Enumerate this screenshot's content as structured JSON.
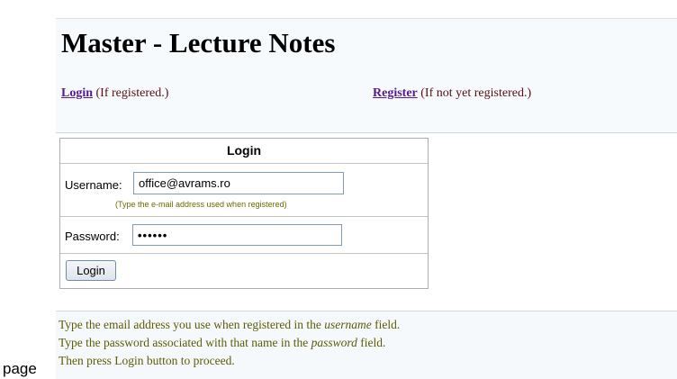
{
  "header": {
    "title": "Master - Lecture Notes",
    "nav": {
      "login_link": "Login",
      "login_note": " (If registered.)",
      "register_link": "Register",
      "register_note": " (If not yet registered.)"
    }
  },
  "login_form": {
    "heading": "Login",
    "username": {
      "label": "Username:",
      "value": "office@avrams.ro",
      "hint": "(Type the e-mail address used when registered)"
    },
    "password": {
      "label": "Password:",
      "masked_value": "••••••"
    },
    "submit_label": "Login"
  },
  "instructions": {
    "line1_a": "Type the email address you use when registered in the ",
    "line1_em": "username",
    "line1_b": " field.",
    "line2_a": "Type the password associated with that name in the ",
    "line2_em": "password",
    "line2_b": " field.",
    "line3": "Then press Login button to proceed."
  },
  "page_label": "page",
  "colors": {
    "link": "#551a8b",
    "note_text": "#5a0d16",
    "instruction_text": "#5c5c05",
    "hint_text": "#6b6b00",
    "input_border": "#7f9db9"
  }
}
